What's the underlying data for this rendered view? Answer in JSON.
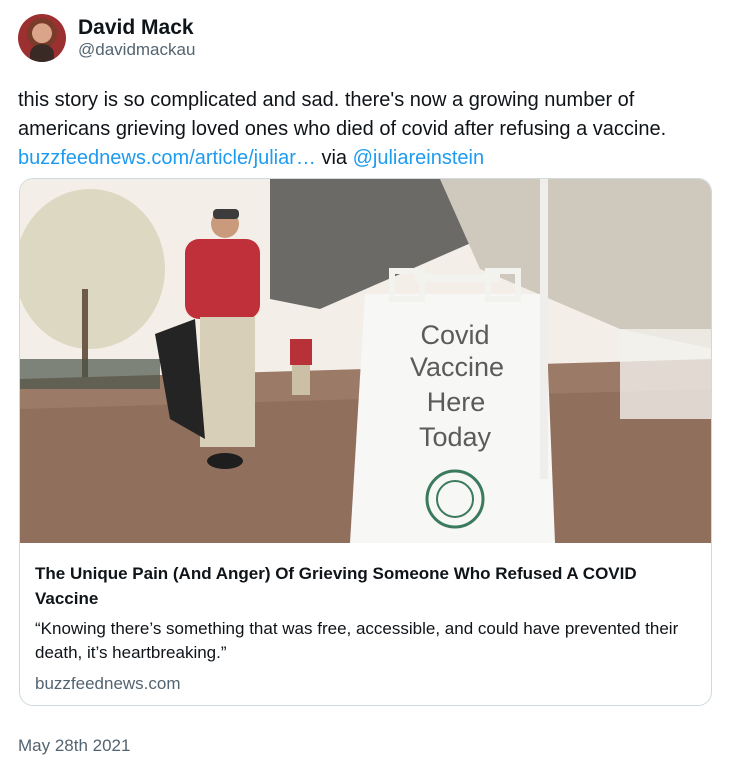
{
  "author": {
    "display_name": "David Mack",
    "handle": "@davidmackau"
  },
  "tweet": {
    "text": "this story is so complicated and sad. there's now a growing number of americans grieving loved ones who died of covid after refusing a vaccine.",
    "link_text": "buzzfeednews.com/article/juliar…",
    "via_text": "via",
    "mention": "@juliareinstein"
  },
  "card": {
    "sign_lines": [
      "Covid",
      "Vaccine",
      "Here",
      "Today"
    ],
    "title": "The Unique Pain (And Anger) Of Grieving Someone Who Refused A COVID Vaccine",
    "description": "“Knowing there’s something that was free, accessible, and could have prevented their death, it’s heartbreaking.”",
    "domain": "buzzfeednews.com"
  },
  "timestamp": "May 28th 2021",
  "colors": {
    "link": "#1d9bf0",
    "secondary_text": "#536471",
    "border": "#cfd9de"
  }
}
